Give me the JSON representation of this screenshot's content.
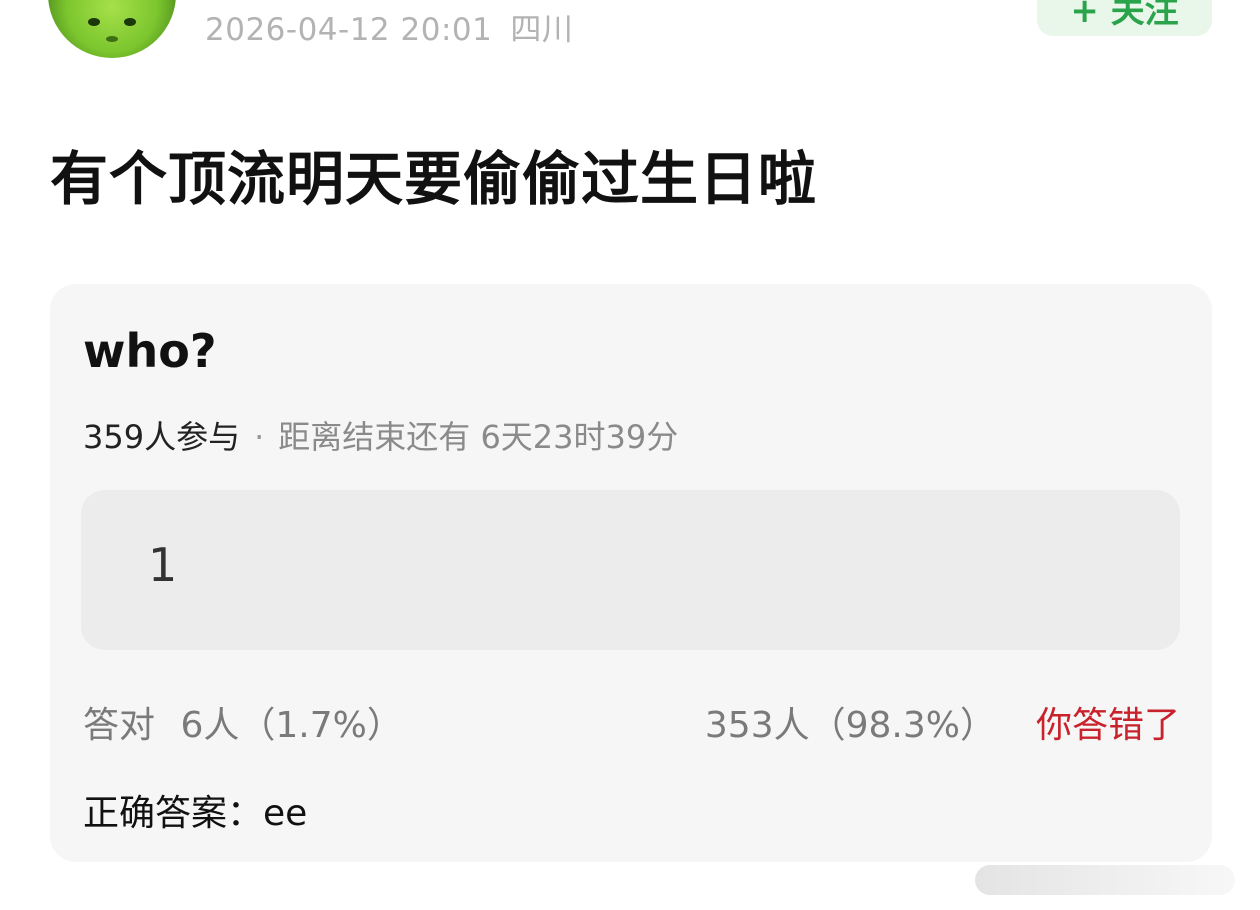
{
  "header": {
    "date": "2026-04-12 20:01",
    "location": "四川",
    "follow_label": "+ 关注"
  },
  "post": {
    "title": "有个顶流明天要偷偷过生日啦"
  },
  "poll": {
    "question": "who?",
    "participants": "359人参与",
    "separator": "·",
    "time_remaining": "距离结束还有 6天23时39分",
    "option": "1",
    "correct_label": "答对",
    "correct_count": "6人（1.7%）",
    "wrong_count": "353人（98.3%）",
    "result_status": "你答错了",
    "answer_label": "正确答案：",
    "answer_value": "ee"
  },
  "colors": {
    "accent_green": "#2aa34a",
    "error_red": "#c8232c",
    "card_bg": "#f6f6f6"
  }
}
